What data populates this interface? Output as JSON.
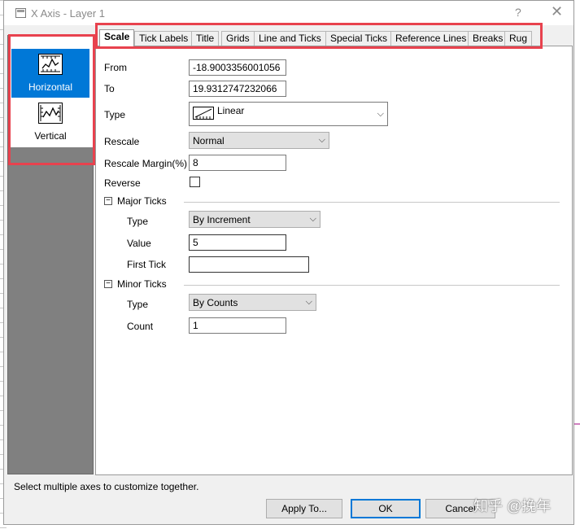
{
  "window": {
    "title": "X Axis - Layer 1",
    "help": "?",
    "close": "✕"
  },
  "axis_list": {
    "items": [
      {
        "label": "Horizontal",
        "selected": true
      },
      {
        "label": "Vertical",
        "selected": false
      }
    ]
  },
  "tabs": [
    "Scale",
    "Tick Labels",
    "Title",
    "Grids",
    "Line and Ticks",
    "Special Ticks",
    "Reference Lines",
    "Breaks",
    "Rug"
  ],
  "active_tab": "Scale",
  "scale": {
    "from_label": "From",
    "from_value": "-18.9003356001056",
    "to_label": "To",
    "to_value": "19.9312747232066",
    "type_label": "Type",
    "type_value": "Linear",
    "rescale_label": "Rescale",
    "rescale_value": "Normal",
    "rescale_margin_label": "Rescale Margin(%)",
    "rescale_margin_value": "8",
    "reverse_label": "Reverse",
    "reverse_checked": false
  },
  "major_ticks": {
    "section_label": "Major Ticks",
    "toggle": "−",
    "type_label": "Type",
    "type_value": "By Increment",
    "value_label": "Value",
    "value_value": "5",
    "first_tick_label": "First Tick",
    "first_tick_value": ""
  },
  "minor_ticks": {
    "section_label": "Minor Ticks",
    "toggle": "−",
    "type_label": "Type",
    "type_value": "By Counts",
    "count_label": "Count",
    "count_value": "1"
  },
  "status_text": "Select multiple axes to customize together.",
  "buttons": {
    "apply_to": "Apply To...",
    "ok": "OK",
    "cancel": "Cancel"
  },
  "watermark": "知乎 @挽年",
  "colors": {
    "highlight_box": "#e8424e",
    "selection": "#0078d7"
  }
}
